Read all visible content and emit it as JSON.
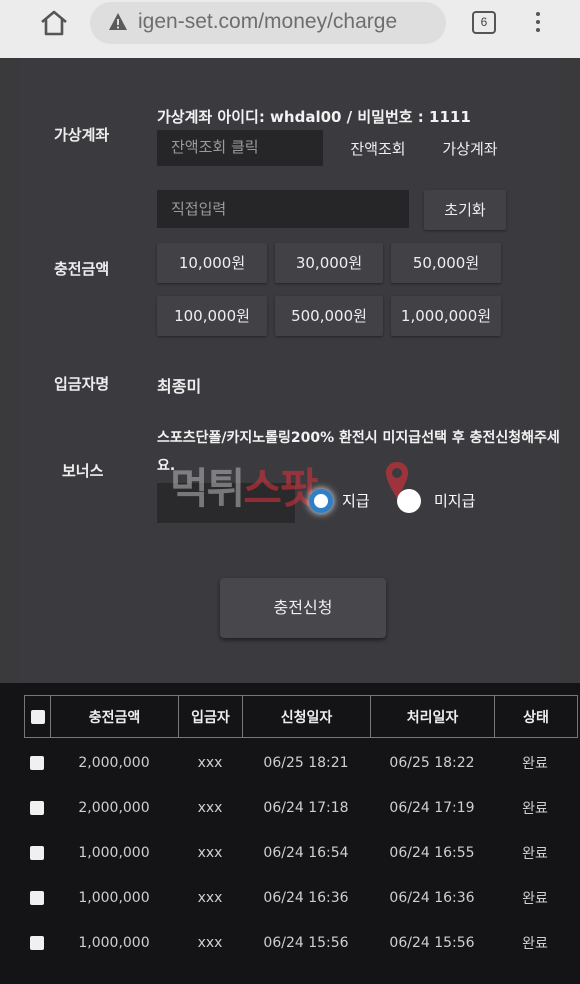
{
  "browser": {
    "url": "igen-set.com/money/charge",
    "tab_count": "6",
    "icons": [
      "home-icon",
      "warning-icon",
      "tabs-icon",
      "menu-icon"
    ]
  },
  "form": {
    "virtual_account_label": "가상계좌",
    "virtual_account_info": "가상계좌 아이디: whdal00 / 비밀번호 : 1111",
    "balance_field_placeholder": "잔액조회 클릭",
    "balance_check_button": "잔액조회",
    "virtual_account_button": "가상계좌",
    "amount_label": "충전금액",
    "amount_input_placeholder": "직접입력",
    "reset_button": "초기화",
    "amount_buttons": [
      "10,000원",
      "30,000원",
      "50,000원",
      "100,000원",
      "500,000원",
      "1,000,000원"
    ],
    "depositor_label": "입금자명",
    "depositor_name": "최종미",
    "bonus_label": "보너스",
    "bonus_notice": "스포츠단폴/카지노롤링200% 환전시 미지급선택 후 충전신청해주세요.",
    "bonus_options": [
      {
        "label": "지급",
        "selected": true
      },
      {
        "label": "미지급",
        "selected": false
      }
    ],
    "submit_button": "충전신청"
  },
  "watermark": {
    "part1": "먹튀",
    "part2": "스팟"
  },
  "table": {
    "headers": [
      "충전금액",
      "입금자",
      "신청일자",
      "처리일자",
      "상태"
    ],
    "rows": [
      {
        "amount": "2,000,000",
        "depositor": "xxx",
        "requested": "06/25 18:21",
        "processed": "06/25 18:22",
        "status": "완료"
      },
      {
        "amount": "2,000,000",
        "depositor": "xxx",
        "requested": "06/24 17:18",
        "processed": "06/24 17:19",
        "status": "완료"
      },
      {
        "amount": "1,000,000",
        "depositor": "xxx",
        "requested": "06/24 16:54",
        "processed": "06/24 16:55",
        "status": "완료"
      },
      {
        "amount": "1,000,000",
        "depositor": "xxx",
        "requested": "06/24 16:36",
        "processed": "06/24 16:36",
        "status": "완료"
      },
      {
        "amount": "1,000,000",
        "depositor": "xxx",
        "requested": "06/24 15:56",
        "processed": "06/24 15:56",
        "status": "완료"
      }
    ]
  }
}
